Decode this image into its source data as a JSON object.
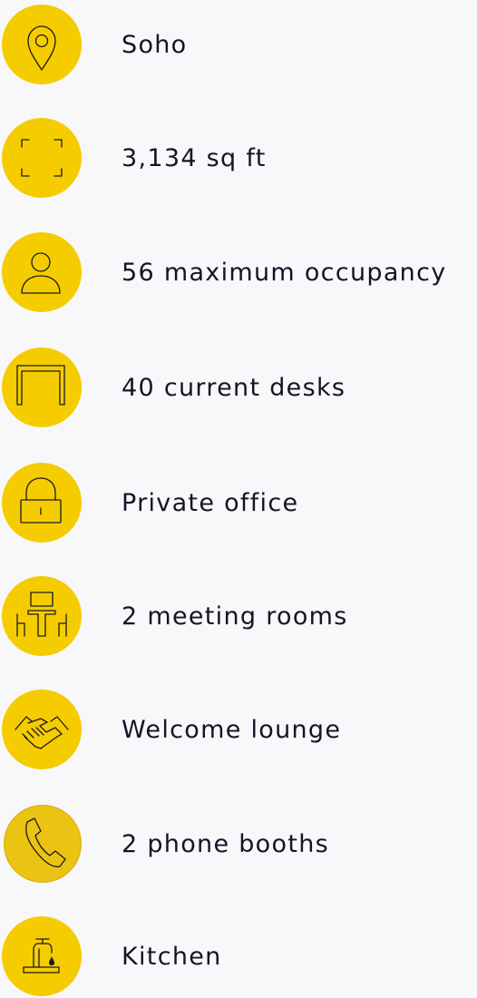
{
  "features": [
    {
      "label": "Soho",
      "icon": "location-pin-icon"
    },
    {
      "label": "3,134 sq ft",
      "icon": "area-frame-icon"
    },
    {
      "label": "56 maximum occupancy",
      "icon": "person-icon"
    },
    {
      "label": "40 current desks",
      "icon": "desk-icon"
    },
    {
      "label": "Private office",
      "icon": "lock-icon"
    },
    {
      "label": "2 meeting rooms",
      "icon": "meeting-table-icon"
    },
    {
      "label": "Welcome lounge",
      "icon": "handshake-icon"
    },
    {
      "label": "2 phone booths",
      "icon": "phone-icon"
    },
    {
      "label": "Kitchen",
      "icon": "faucet-icon"
    }
  ],
  "colors": {
    "background": "#f8f8fb",
    "icon_circle": "#f5cc00",
    "icon_circle_muted": "#ebc312",
    "text": "#141426"
  }
}
